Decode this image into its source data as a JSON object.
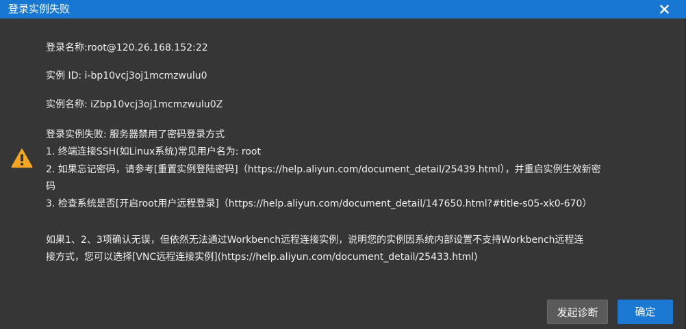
{
  "dialog": {
    "title": "登录实例失败"
  },
  "info": {
    "login_name": "登录名称:root@120.26.168.152:22",
    "instance_id": "实例 ID: i-bp10vcj3oj1mcmzwulu0",
    "instance_name": "实例名称: iZbp10vcj3oj1mcmzwulu0Z"
  },
  "error": {
    "lines": [
      "登录实例失败: 服务器禁用了密码登录方式",
      "1. 终端连接SSH(如Linux系统)常见用户名为: root",
      "2. 如果忘记密码，请参考[重置实例登陆密码]（https://help.aliyun.com/document_detail/25439.html），并重启实例生效新密",
      "码",
      "3. 检查系统是否[开启root用户远程登录]（https://help.aliyun.com/document_detail/147650.html?#title-s05-xk0-670）"
    ]
  },
  "conclusion": {
    "lines": [
      "如果1、2、3项确认无误，但依然无法通过Workbench远程连接实例，说明您的实例因系统内部设置不支持Workbench远程连",
      "接方式，您可以选择[VNC远程连接实例](https://help.aliyun.com/document_detail/25433.html)"
    ]
  },
  "buttons": {
    "diagnose": "发起诊断",
    "ok": "确定"
  },
  "colors": {
    "title_bar": "#1877d2",
    "background": "#363636",
    "warning": "#f5a623",
    "primary_button": "#1b78d3",
    "secondary_button": "#5a5a5a"
  },
  "icons": {
    "close": "close-icon",
    "warning": "warning-icon"
  }
}
